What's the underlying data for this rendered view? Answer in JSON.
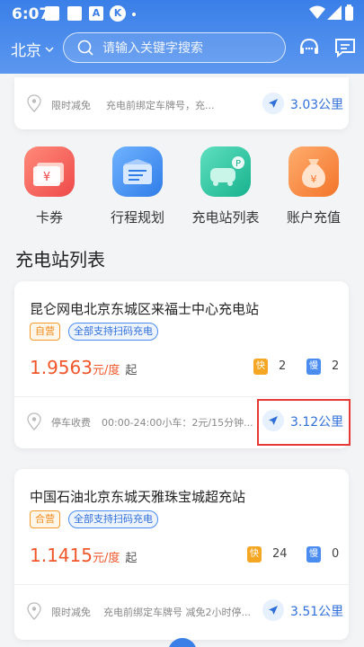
{
  "status_bar": {
    "time": "6:07",
    "icons": [
      "app-square-icon",
      "app-square-icon",
      "app-square-icon",
      "a-badge-icon",
      "k-circle-icon"
    ]
  },
  "nav": {
    "city": "北京",
    "search_placeholder": "请输入关键字搜索"
  },
  "top_card": {
    "discount": "限时减免",
    "note": "充电前绑定车牌号，充...",
    "distance": "3.03公里"
  },
  "quick_actions": [
    {
      "label": "卡券",
      "color": "#f25a5a"
    },
    {
      "label": "行程规划",
      "color": "#3d8ef0"
    },
    {
      "label": "充电站列表",
      "color": "#27c3a0"
    },
    {
      "label": "账户充值",
      "color": "#f5863a"
    }
  ],
  "section_title": "充电站列表",
  "stations": [
    {
      "name": "昆仑网电北京东城区来福士中心充电站",
      "tag_type": "自营",
      "tag_scan": "全部支持扫码充电",
      "price": "1.9563",
      "price_unit": "元/度",
      "price_suffix": "起",
      "fast_label": "快",
      "fast_count": "2",
      "slow_label": "慢",
      "slow_count": "2",
      "foot_label": "停车收费",
      "foot_note": "00:00-24:00小车：2元/15分钟...",
      "distance": "3.12公里"
    },
    {
      "name": "中国石油北京东城天雅珠宝城超充站",
      "tag_type": "合营",
      "tag_scan": "全部支持扫码充电",
      "price": "1.1415",
      "price_unit": "元/度",
      "price_suffix": "起",
      "fast_label": "快",
      "fast_count": "24",
      "slow_label": "慢",
      "slow_count": "0",
      "foot_label": "限时减免",
      "foot_note": "充电前绑定车牌号 减免2小时停...",
      "distance": "3.51公里"
    }
  ]
}
